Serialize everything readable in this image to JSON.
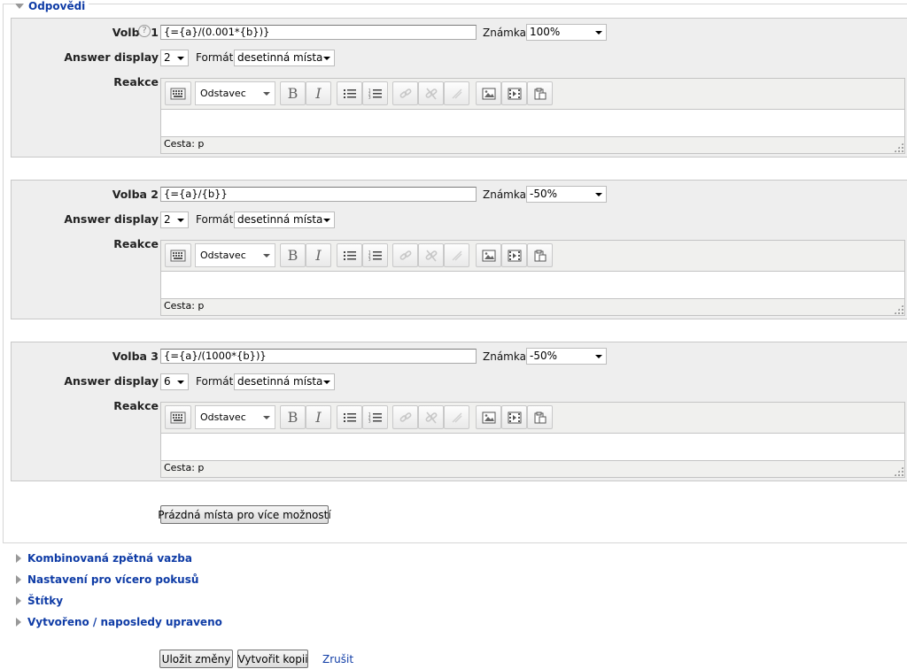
{
  "section_title": "Odpovědi",
  "labels": {
    "answer_display": "Answer display",
    "format": "Formát",
    "grade": "Známka",
    "feedback": "Reakce"
  },
  "editor": {
    "paragraph_format": "Odstavec",
    "path_label": "Cesta: p"
  },
  "answers": [
    {
      "label": "Volba 1",
      "formula": "{={a}/(0.001*{b})}",
      "grade": "100%",
      "answer_display": "2",
      "format": "desetinná místa",
      "has_help_icon": true
    },
    {
      "label": "Volba 2",
      "formula": "{={a}/{b}}",
      "grade": "-50%",
      "answer_display": "2",
      "format": "desetinná místa"
    },
    {
      "label": "Volba 3",
      "formula": "{={a}/(1000*{b})}",
      "grade": "-50%",
      "answer_display": "6",
      "format": "desetinná místa"
    }
  ],
  "add_blanks_button": "Prázdná místa pro více možností",
  "collapsed_sections": [
    "Kombinovaná zpětná vazba",
    "Nastavení pro vícero pokusů",
    "Štítky",
    "Vytvořeno / naposledy upraveno"
  ],
  "footer": {
    "save_label": "Uložit změny",
    "copy_label": "Vytvořit kopii",
    "cancel_label": "Zrušit"
  },
  "colors": {
    "link": "#0f3ca6",
    "panel_bg": "#eeeeee"
  }
}
